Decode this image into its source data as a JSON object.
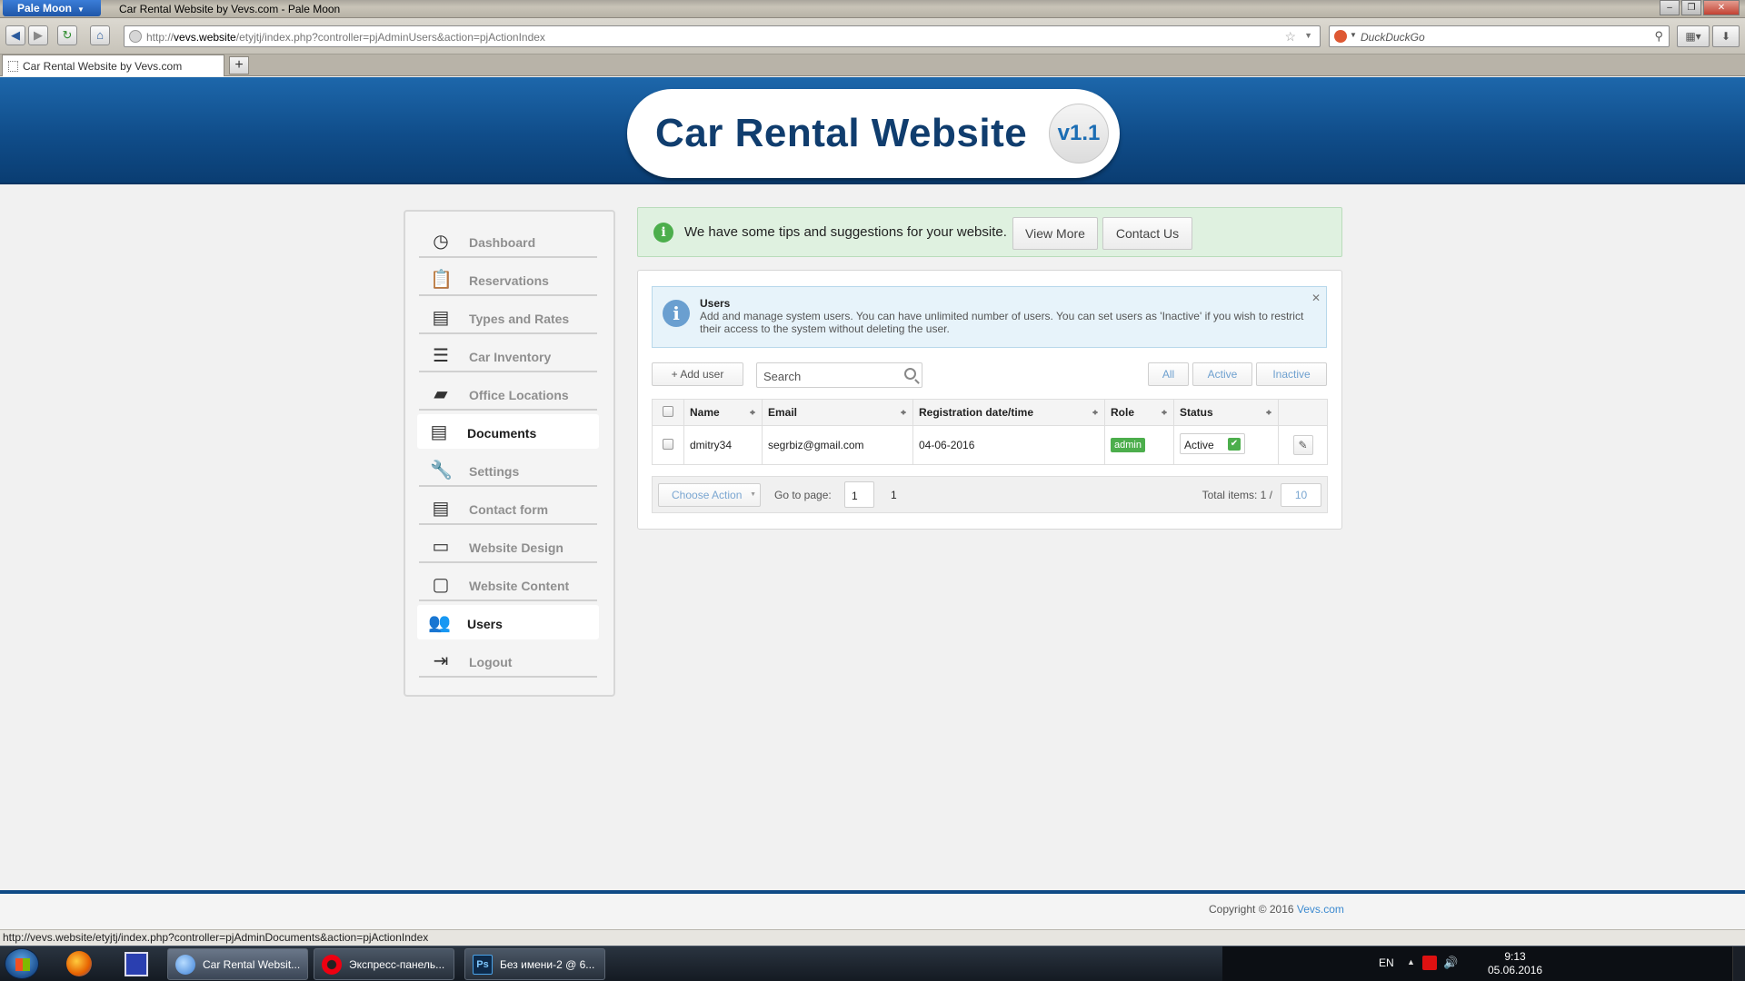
{
  "browser": {
    "app_menu": "Pale Moon",
    "window_title": "Car Rental Website by Vevs.com - Pale Moon",
    "url_prefix": "http://",
    "url_domain": "vevs.website",
    "url_path": "/etyjtj/index.php?controller=pjAdminUsers&action=pjActionIndex",
    "search_placeholder": "DuckDuckGo",
    "tab_title": "Car Rental Website by Vevs.com",
    "status_url": "http://vevs.website/etyjtj/index.php?controller=pjAdminDocuments&action=pjActionIndex"
  },
  "header": {
    "logo_text": "Car Rental Website",
    "version": "v1.1"
  },
  "sidebar": {
    "items": [
      {
        "label": "Dashboard",
        "icon": "dashboard-icon",
        "glyph": "◷",
        "active": false
      },
      {
        "label": "Reservations",
        "icon": "clipboard-icon",
        "glyph": "📋",
        "active": false
      },
      {
        "label": "Types and Rates",
        "icon": "document-icon",
        "glyph": "▤",
        "active": false
      },
      {
        "label": "Car Inventory",
        "icon": "list-icon",
        "glyph": "☰",
        "active": false
      },
      {
        "label": "Office Locations",
        "icon": "folder-icon",
        "glyph": "▰",
        "active": false
      },
      {
        "label": "Documents",
        "icon": "document-icon",
        "glyph": "▤",
        "active": true
      },
      {
        "label": "Settings",
        "icon": "wrench-icon",
        "glyph": "🔧",
        "active": false
      },
      {
        "label": "Contact form",
        "icon": "document-icon",
        "glyph": "▤",
        "active": false
      },
      {
        "label": "Website Design",
        "icon": "monitor-icon",
        "glyph": "▭",
        "active": false
      },
      {
        "label": "Website Content",
        "icon": "window-icon",
        "glyph": "▢",
        "active": false
      },
      {
        "label": "Users",
        "icon": "users-icon",
        "glyph": "👥",
        "active": true
      },
      {
        "label": "Logout",
        "icon": "logout-icon",
        "glyph": "⇥",
        "active": false
      }
    ]
  },
  "tips": {
    "message": "We have some tips and suggestions for your website.",
    "view_more": "View More",
    "contact_us": "Contact Us"
  },
  "users_panel": {
    "info_title": "Users",
    "info_text": "Add and manage system users. You can have unlimited number of users. You can set users as 'Inactive' if you wish to restrict their access to the system without deleting the user.",
    "add_user": "+ Add user",
    "search_placeholder": "Search",
    "filters": [
      "All",
      "Active",
      "Inactive"
    ],
    "columns": [
      "Name",
      "Email",
      "Registration date/time",
      "Role",
      "Status"
    ],
    "rows": [
      {
        "name": "dmitry34",
        "email": "segrbiz@gmail.com",
        "registered": "04-06-2016",
        "role": "admin",
        "status": "Active"
      }
    ],
    "pager": {
      "choose_action": "Choose Action",
      "goto_label": "Go to page:",
      "page_input": "1",
      "page_number": "1",
      "total_label": "Total items: 1 /",
      "per_page": "10"
    }
  },
  "footer": {
    "copyright": "Copyright © 2016 ",
    "link": "Vevs.com"
  },
  "taskbar": {
    "windows": [
      {
        "label": "Car Rental Websit...",
        "active": true
      },
      {
        "label": "Экспресс-панель...",
        "active": false
      },
      {
        "label": "Без имени-2 @ 6...",
        "active": false
      }
    ],
    "lang": "EN",
    "time": "9:13",
    "date": "05.06.2016"
  },
  "colors": {
    "header_blue": "#104d8a",
    "active_green": "#4cae4c",
    "link_blue": "#3c8ad0"
  }
}
